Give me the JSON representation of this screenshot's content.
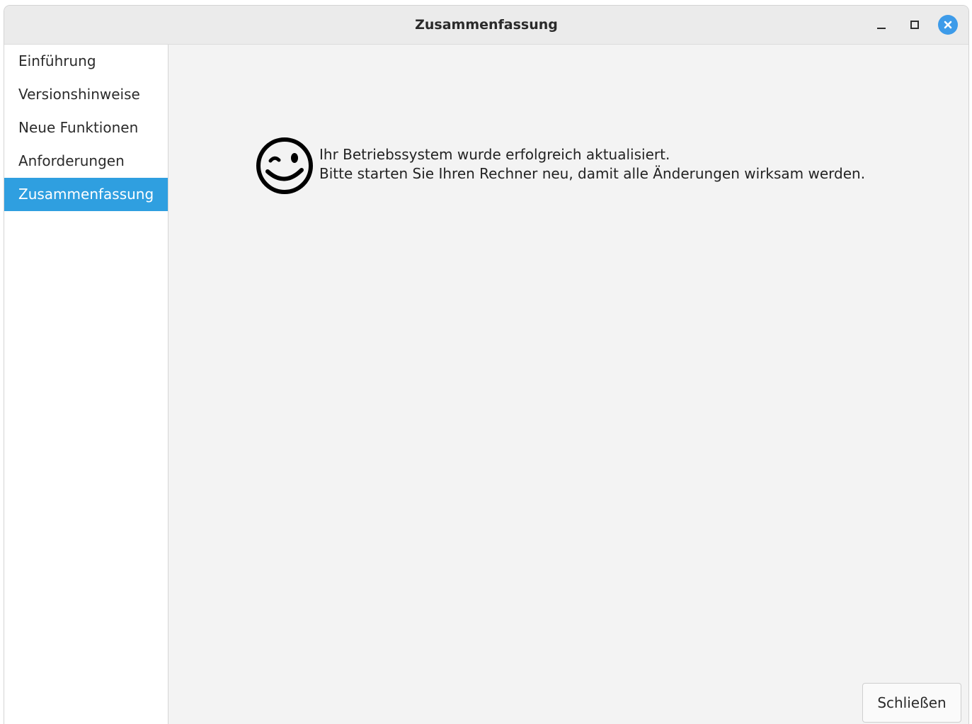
{
  "window": {
    "title": "Zusammenfassung"
  },
  "window_controls": {
    "minimize_icon": "minimize-icon",
    "maximize_icon": "maximize-icon",
    "close_icon": "close-icon",
    "close_color": "#3d9be9"
  },
  "sidebar": {
    "items": [
      {
        "label": "Einführung",
        "active": false
      },
      {
        "label": "Versionshinweise",
        "active": false
      },
      {
        "label": "Neue Funktionen",
        "active": false
      },
      {
        "label": "Anforderungen",
        "active": false
      },
      {
        "label": "Zusammenfassung",
        "active": true
      }
    ],
    "active_color": "#2f9fe0"
  },
  "main": {
    "icon": "wink-smiley-icon",
    "message_line1": "Ihr Betriebssystem wurde erfolgreich aktualisiert.",
    "message_line2": "Bitte starten Sie Ihren Rechner neu, damit alle Änderungen wirksam werden."
  },
  "footer": {
    "close_label": "Schließen"
  }
}
